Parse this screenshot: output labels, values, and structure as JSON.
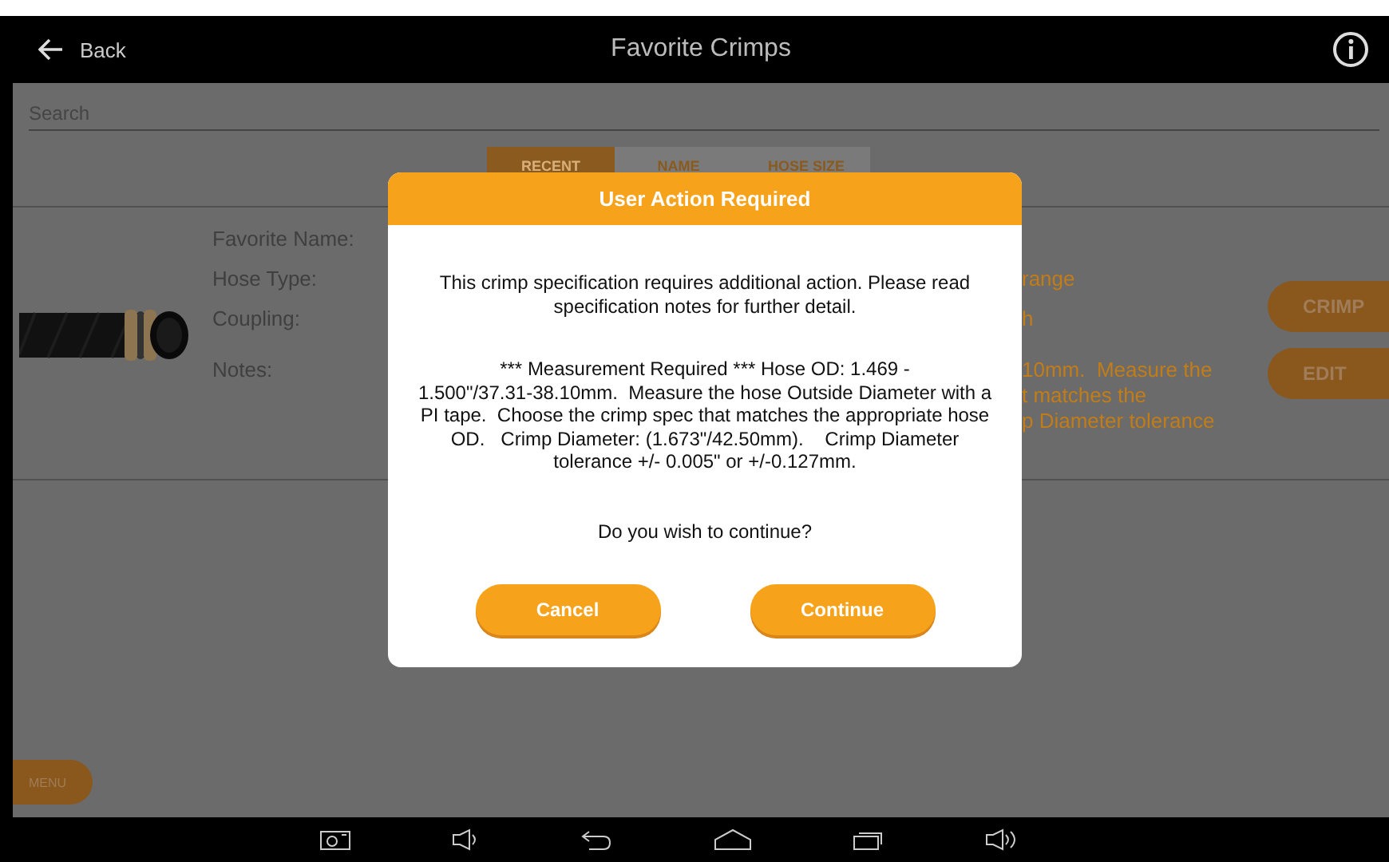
{
  "header": {
    "back_label": "Back",
    "title": "Favorite Crimps"
  },
  "search": {
    "placeholder": "Search"
  },
  "sort_tabs": [
    {
      "label": "RECENT",
      "selected": true
    },
    {
      "label": "NAME",
      "selected": false
    },
    {
      "label": "HOSE SIZE",
      "selected": false
    }
  ],
  "favorite": {
    "fields": [
      {
        "label": "Favorite Name:"
      },
      {
        "label": "Hose Type:",
        "value_lines": [
          "range"
        ]
      },
      {
        "label": "Coupling:",
        "value_lines": [
          "h"
        ]
      },
      {
        "label": "Notes:",
        "value_lines": [
          "10mm.  Measure the",
          "t matches the",
          "p Diameter tolerance"
        ]
      }
    ],
    "actions": [
      "CRIMP",
      "EDIT"
    ]
  },
  "menu_button": "MENU",
  "dialog": {
    "title": "User Action Required",
    "message_lines": [
      "This crimp specification requires additional action. Please read",
      "specification notes for further detail."
    ],
    "notes_lines": [
      "*** Measurement Required *** Hose OD: 1.469 -",
      "1.500\"/37.31-38.10mm.  Measure the hose Outside Diameter with a",
      "PI tape.  Choose the crimp spec that matches the appropriate hose",
      "OD.   Crimp Diameter: (1.673\"/42.50mm).    Crimp Diameter",
      "tolerance +/- 0.005\" or +/-0.127mm."
    ],
    "question": "Do you wish to continue?",
    "buttons": [
      "Cancel",
      "Continue"
    ]
  }
}
